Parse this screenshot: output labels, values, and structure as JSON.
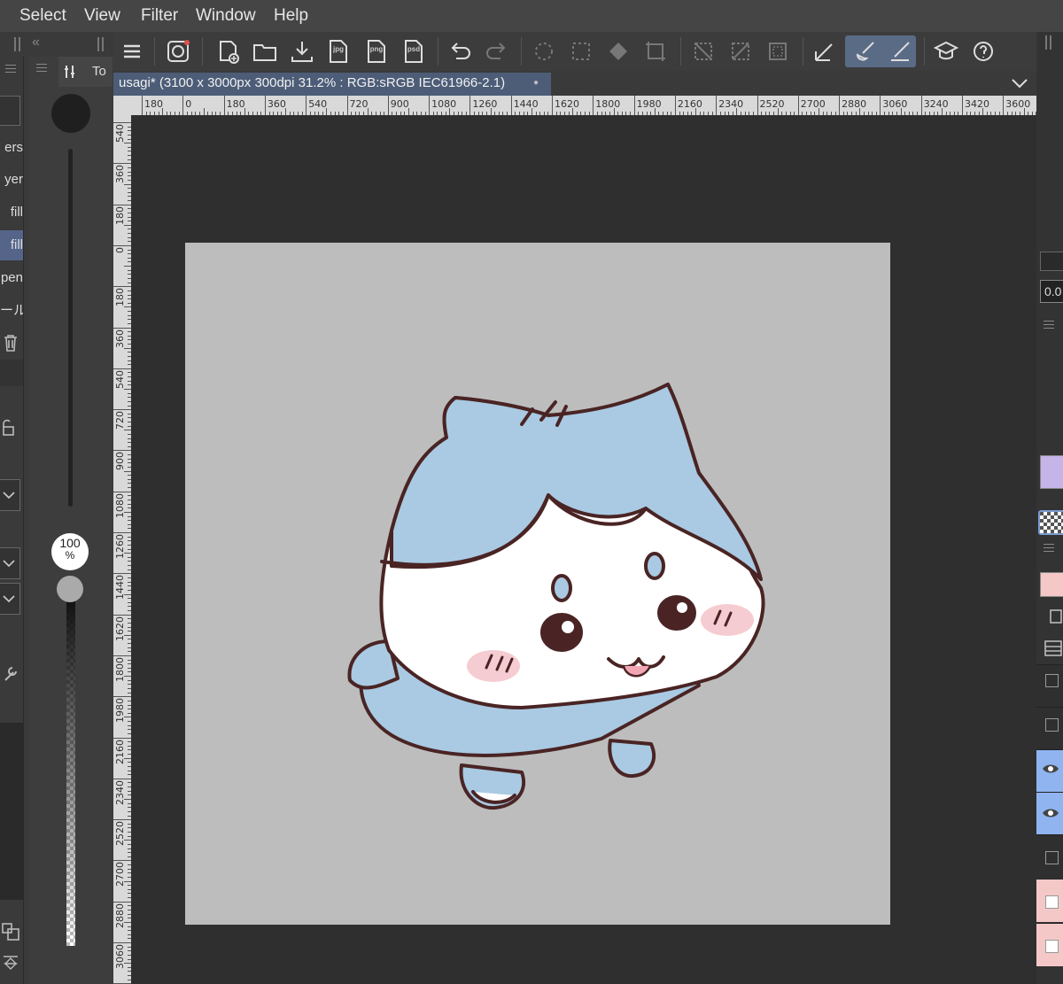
{
  "menu": [
    "Select",
    "View",
    "Filter",
    "Window",
    "Help"
  ],
  "document": {
    "title": "usagi* (3100 x 3000px 300dpi 31.2% : RGB:sRGB IEC61966-2.1)",
    "modified_dot": "●"
  },
  "toolbar": {
    "labels": {
      "jpg": "jpg",
      "png": "png",
      "psd": "psd"
    },
    "buttons": [
      "menu",
      "companion",
      "new",
      "open",
      "import",
      "export-jpg",
      "export-png",
      "export-psd",
      "undo",
      "redo",
      "select-all",
      "deselect",
      "fill",
      "transform",
      "clear",
      "clear-outside",
      "invert-selection",
      "pen",
      "brush",
      "eraser",
      "learn",
      "help"
    ],
    "active": "brush"
  },
  "ruler": {
    "top": [
      "180",
      "0",
      "180",
      "360",
      "540",
      "720",
      "900",
      "1080",
      "1260",
      "1440",
      "1620",
      "1800",
      "1980",
      "2160",
      "2340",
      "2520",
      "2700",
      "2880",
      "3060",
      "3240",
      "3420",
      "3600"
    ],
    "left": [
      "540",
      "360",
      "180",
      "0",
      "180",
      "360",
      "540",
      "720",
      "900",
      "1080",
      "1260",
      "1440",
      "1620",
      "1800",
      "1980",
      "2160",
      "2340",
      "2520",
      "2700",
      "2880",
      "3060"
    ]
  },
  "left_panel": {
    "items": [
      "ers",
      "yer",
      "fill",
      "fill",
      "pen",
      "ール"
    ],
    "selected_index": 3
  },
  "brush_panel": {
    "tab_label": "To",
    "opacity_value": "100",
    "opacity_unit": "%"
  },
  "right_panel": {
    "value": "0.0"
  },
  "colors": {
    "accent": "#55658a",
    "canvas_bg": "#bdbdbd",
    "character_blue": "#a9cae2",
    "outline": "#4a2424",
    "blush": "#f4c6cc"
  }
}
